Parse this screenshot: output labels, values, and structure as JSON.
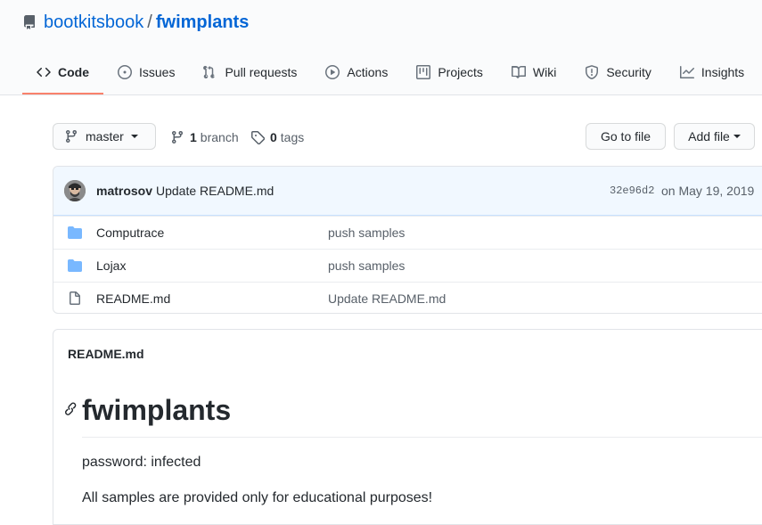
{
  "repo": {
    "owner": "bootkitsbook",
    "separator": "/",
    "name": "fwimplants"
  },
  "tabs": [
    {
      "label": "Code",
      "icon": "code-icon",
      "selected": true
    },
    {
      "label": "Issues",
      "icon": "issue-icon"
    },
    {
      "label": "Pull requests",
      "icon": "pull-request-icon"
    },
    {
      "label": "Actions",
      "icon": "play-icon"
    },
    {
      "label": "Projects",
      "icon": "project-icon"
    },
    {
      "label": "Wiki",
      "icon": "book-icon"
    },
    {
      "label": "Security",
      "icon": "shield-icon"
    },
    {
      "label": "Insights",
      "icon": "graph-icon"
    }
  ],
  "toolbar": {
    "branch": "master",
    "branch_count": "1",
    "branch_label": "branch",
    "tag_count": "0",
    "tag_label": "tags",
    "go_to_file": "Go to file",
    "add_file": "Add file"
  },
  "commit": {
    "author": "matrosov",
    "message": "Update README.md",
    "sha": "32e96d2",
    "date": "on May 19, 2019"
  },
  "files": [
    {
      "type": "folder",
      "name": "Computrace",
      "commit": "push samples"
    },
    {
      "type": "folder",
      "name": "Lojax",
      "commit": "push samples"
    },
    {
      "type": "file",
      "name": "README.md",
      "commit": "Update README.md"
    }
  ],
  "readme": {
    "header": "README.md",
    "title": "fwimplants",
    "paragraphs": [
      "password: infected",
      "All samples are provided only for educational purposes!"
    ]
  },
  "colors": {
    "link": "#0366d6",
    "folder": "#79b8ff",
    "selected_tab": "#f9826c"
  }
}
